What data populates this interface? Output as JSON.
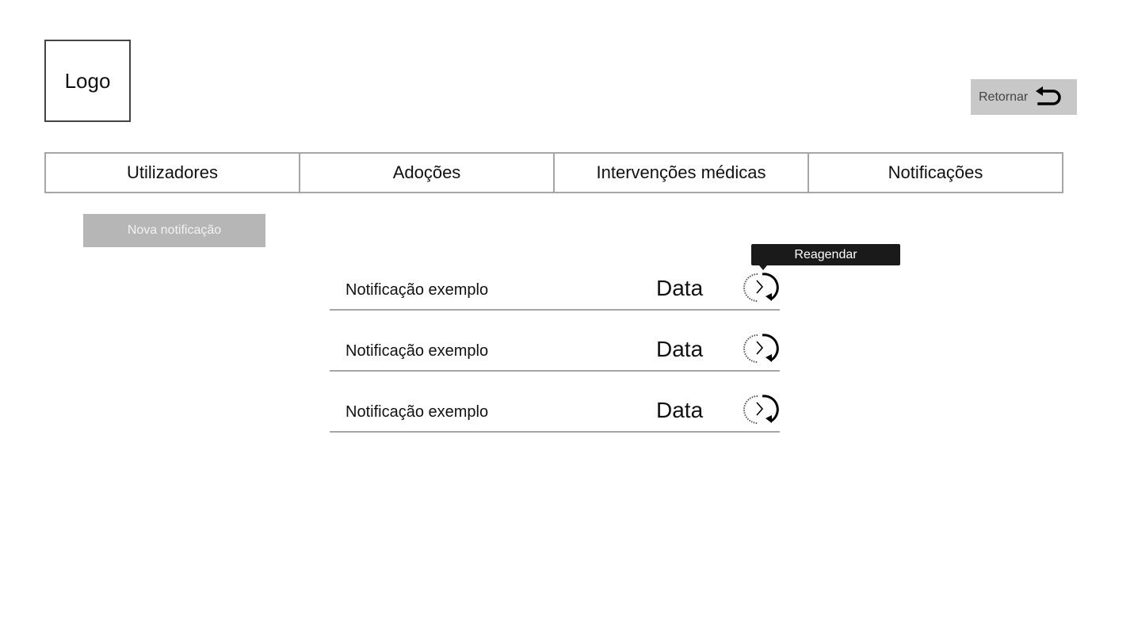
{
  "header": {
    "logo_text": "Logo",
    "back_label": "Retornar"
  },
  "tabs": [
    {
      "label": "Utilizadores"
    },
    {
      "label": "Adoções"
    },
    {
      "label": "Intervenções médicas"
    },
    {
      "label": "Notificações"
    }
  ],
  "actions": {
    "new_notification_label": "Nova notificação"
  },
  "tooltip": {
    "text": "Reagendar"
  },
  "notifications": [
    {
      "title": "Notificação exemplo",
      "date": "Data",
      "action_icon": "reschedule-icon"
    },
    {
      "title": "Notificação exemplo",
      "date": "Data",
      "action_icon": "reschedule-icon"
    },
    {
      "title": "Notificação exemplo",
      "date": "Data",
      "action_icon": "reschedule-icon"
    }
  ],
  "icons": {
    "back": "undo-arrow-icon",
    "reschedule": "reschedule-icon"
  },
  "colors": {
    "back_button_bg": "#c8c8c8",
    "new_button_bg": "#b6b6b6",
    "tooltip_bg": "#1a1a1a",
    "border": "#a6a6a6"
  }
}
